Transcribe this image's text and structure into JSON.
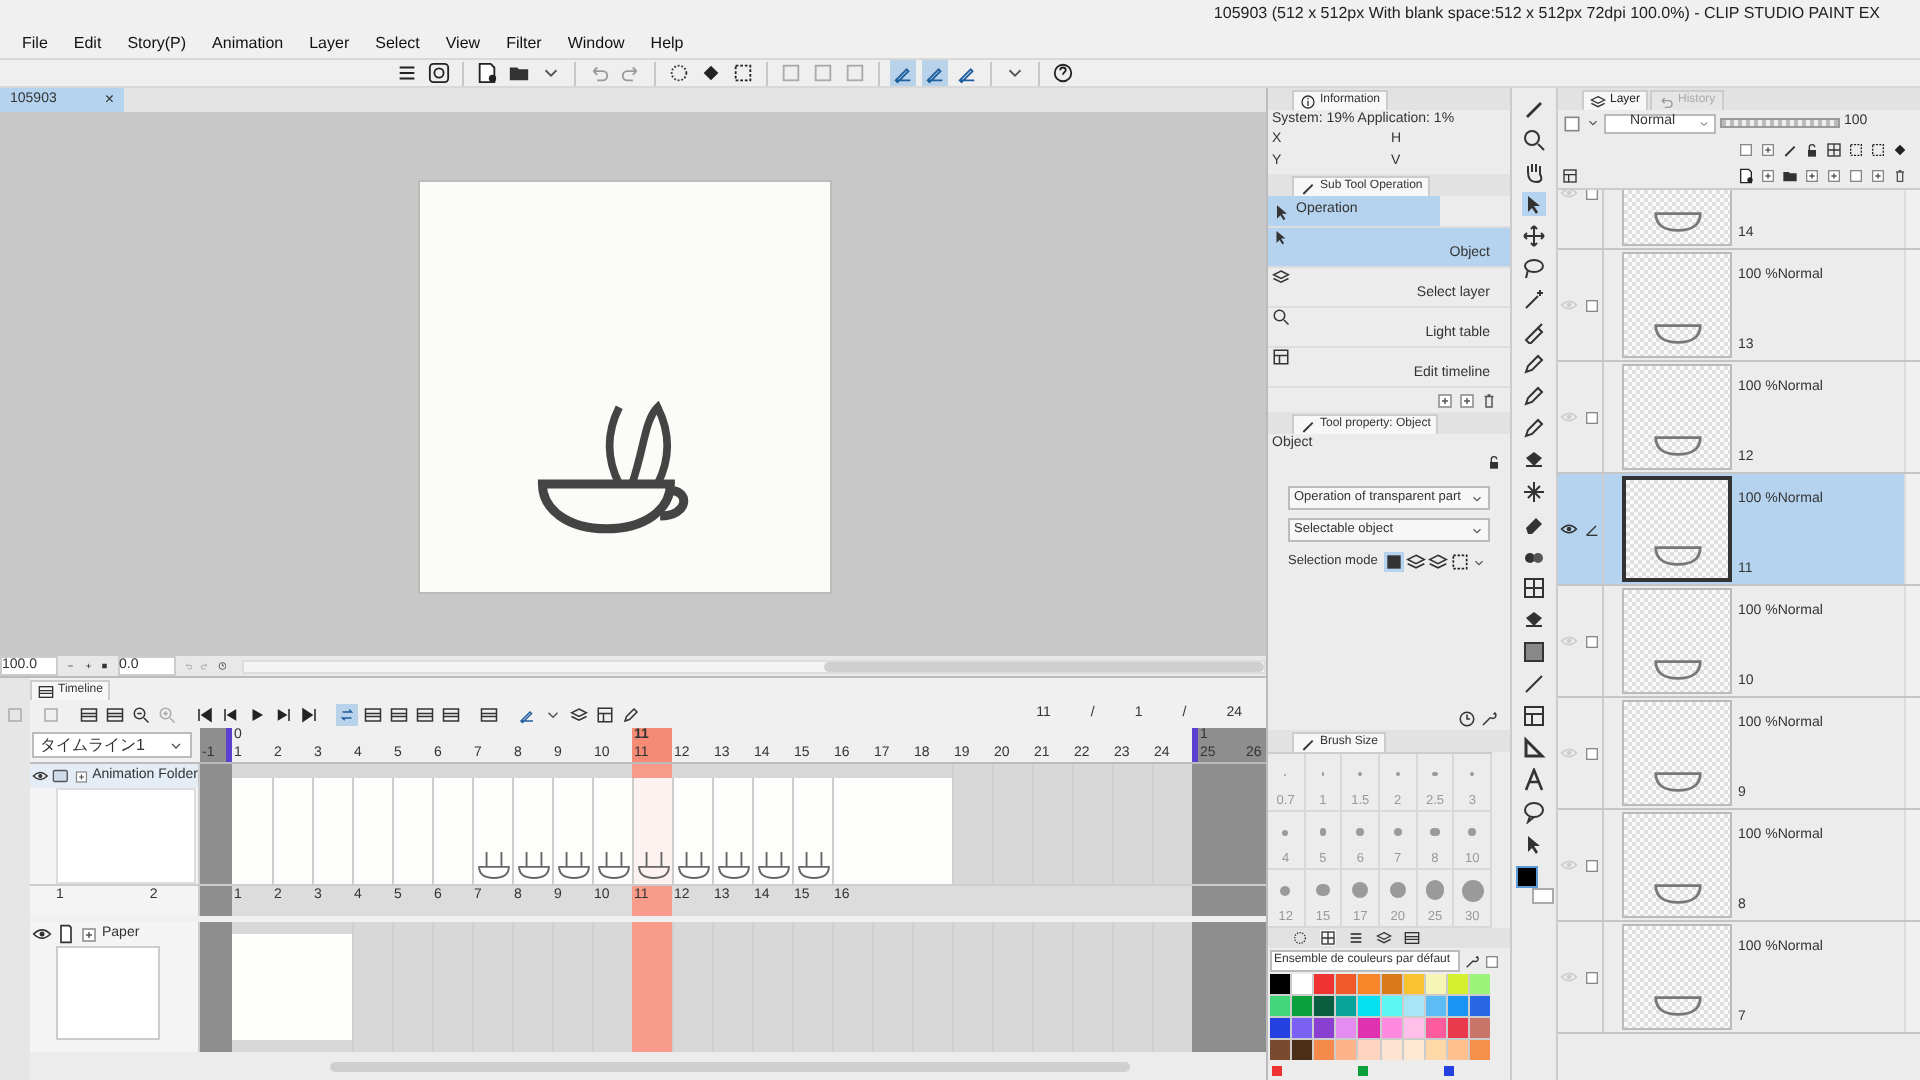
{
  "window": {
    "title": "105903 (512 x 512px With blank space:512 x 512px 72dpi 100.0%)  - CLIP STUDIO PAINT EX"
  },
  "menu": [
    "File",
    "Edit",
    "Story(P)",
    "Animation",
    "Layer",
    "Select",
    "View",
    "Filter",
    "Window",
    "Help"
  ],
  "document_tab": {
    "label": "105903",
    "close": "×",
    "selected": true
  },
  "canvas_status": {
    "zoom": "100.0",
    "angle": "0.0"
  },
  "information": {
    "title": "Information",
    "usage": "System: 19% Application:  1%",
    "labels": [
      "X",
      "Y",
      "H",
      "V"
    ]
  },
  "sub_tool": {
    "title": "Sub Tool Operation",
    "group": "Operation",
    "items": [
      {
        "label": "Object",
        "selected": true
      },
      {
        "label": "Select layer",
        "selected": false
      },
      {
        "label": "Light table",
        "selected": false
      },
      {
        "label": "Edit timeline",
        "selected": false
      }
    ]
  },
  "tool_property": {
    "title": "Tool property: Object",
    "name": "Object",
    "dropdowns": [
      "Operation of transparent part",
      "Selectable object"
    ],
    "selection_mode": "Selection mode"
  },
  "brush_size": {
    "title": "Brush Size",
    "sizes": [
      "0.7",
      "1",
      "1.5",
      "2",
      "2.5",
      "3",
      "4",
      "5",
      "6",
      "7",
      "8",
      "10",
      "12",
      "15",
      "17",
      "20",
      "25",
      "30"
    ]
  },
  "color_set": {
    "name": "Ensemble de couleurs par défaut",
    "colors": [
      {
        "color": "#000000"
      },
      {
        "color": "#ffffff"
      },
      {
        "color": "#ef3333"
      },
      {
        "color": "#f0592a"
      },
      {
        "color": "#f7862b"
      },
      {
        "color": "#d9791a"
      },
      {
        "color": "#f9c22e"
      },
      {
        "color": "#f7f5b5"
      },
      {
        "color": "#d4f02e"
      },
      {
        "color": "#9cf57a"
      },
      {
        "color": "#44d67a"
      },
      {
        "color": "#08a03a"
      },
      {
        "color": "#095e3f"
      },
      {
        "color": "#0aa39a"
      },
      {
        "color": "#06e0f0"
      },
      {
        "color": "#5ef5f5"
      },
      {
        "color": "#a8e5f7"
      },
      {
        "color": "#5cbcf5"
      },
      {
        "color": "#1994f5"
      },
      {
        "color": "#2867e6"
      },
      {
        "color": "#2340e0"
      },
      {
        "color": "#7a60f5"
      },
      {
        "color": "#8a3fd1"
      },
      {
        "color": "#e58cf0"
      },
      {
        "color": "#e031b0"
      },
      {
        "color": "#ff8ae0"
      },
      {
        "color": "#ffbfe8"
      },
      {
        "color": "#ff5c9e"
      },
      {
        "color": "#e83a4a"
      },
      {
        "color": "#c9756a"
      },
      {
        "color": "#7a4a30"
      },
      {
        "color": "#4a2e18"
      },
      {
        "color": "#f58a4a"
      },
      {
        "color": "#ffb38a"
      },
      {
        "color": "#ffd3bf"
      },
      {
        "color": "#ffe3d1"
      },
      {
        "color": "#ffe8d1"
      },
      {
        "color": "#ffd8a8"
      },
      {
        "color": "#ffc090"
      },
      {
        "color": "#f58f4a"
      }
    ],
    "recent": [
      {
        "color": "#ef3333"
      },
      {
        "color": "#08a03a"
      },
      {
        "color": "#2340e0"
      }
    ]
  },
  "layer_panel": {
    "tabs": [
      {
        "label": "Layer",
        "selected": true
      },
      {
        "label": "History",
        "selected": false
      }
    ],
    "blend": "Normal",
    "opacity_slider": {
      "level": 1
    },
    "opacity": "100",
    "layers": [
      {
        "number": "14",
        "selected": false
      },
      {
        "number": "13",
        "info": "100 %Normal",
        "selected": false
      },
      {
        "number": "12",
        "info": "100 %Normal",
        "selected": false
      },
      {
        "number": "11",
        "info": "100 %Normal",
        "selected": true
      },
      {
        "number": "10",
        "info": "100 %Normal",
        "selected": false
      },
      {
        "number": "9",
        "info": "100 %Normal",
        "selected": false
      },
      {
        "number": "8",
        "info": "100 %Normal",
        "selected": false
      },
      {
        "number": "7",
        "info": "100 %Normal",
        "selected": false
      }
    ]
  },
  "timeline": {
    "title": "Timeline",
    "counter": [
      "11",
      "/",
      "1",
      "/",
      "24"
    ],
    "name": "タイムライン1",
    "ruler": [
      {
        "label": "-1",
        "kind": "out",
        "selected": false
      },
      {
        "label": "1",
        "mark": "0",
        "kind": "frame",
        "selected": false
      },
      {
        "label": "2",
        "kind": "frame",
        "selected": false
      },
      {
        "label": "3",
        "kind": "frame",
        "selected": false
      },
      {
        "label": "4",
        "kind": "frame",
        "selected": false
      },
      {
        "label": "5",
        "kind": "frame",
        "selected": false
      },
      {
        "label": "6",
        "kind": "frame",
        "selected": false
      },
      {
        "label": "7",
        "kind": "frame",
        "selected": false
      },
      {
        "label": "8",
        "kind": "frame",
        "selected": false
      },
      {
        "label": "9",
        "kind": "frame",
        "selected": false
      },
      {
        "label": "10",
        "kind": "frame",
        "selected": false
      },
      {
        "label": "11",
        "mark": "11",
        "kind": "frame",
        "selected": true
      },
      {
        "label": "12",
        "kind": "frame",
        "selected": false
      },
      {
        "label": "13",
        "kind": "frame",
        "selected": false
      },
      {
        "label": "14",
        "kind": "frame",
        "selected": false
      },
      {
        "label": "15",
        "kind": "frame",
        "selected": false
      },
      {
        "label": "16",
        "kind": "frame",
        "selected": false
      },
      {
        "label": "17",
        "kind": "frame",
        "selected": false
      },
      {
        "label": "18",
        "kind": "frame",
        "selected": false
      },
      {
        "label": "19",
        "kind": "frame",
        "selected": false
      },
      {
        "label": "20",
        "kind": "frame",
        "selected": false
      },
      {
        "label": "21",
        "kind": "frame",
        "selected": false
      },
      {
        "label": "22",
        "kind": "frame",
        "selected": false
      },
      {
        "label": "23",
        "kind": "frame",
        "selected": false
      },
      {
        "label": "24",
        "kind": "frame",
        "selected": false
      },
      {
        "label": "25",
        "mark": "1",
        "kind": "out",
        "selected": false
      },
      {
        "label": "26",
        "kind": "out",
        "selected": false
      }
    ],
    "tracks": [
      {
        "label": "Animation Folder",
        "kind": "folder",
        "header_ruler": [
          "1",
          "2"
        ],
        "cels": [
          {
            "label": "1",
            "drawn": false
          },
          {
            "label": "2",
            "drawn": false
          },
          {
            "label": "3",
            "drawn": false
          },
          {
            "label": "4",
            "drawn": false
          },
          {
            "label": "5",
            "drawn": false
          },
          {
            "label": "6",
            "drawn": false
          },
          {
            "label": "7",
            "drawn": true
          },
          {
            "label": "8",
            "drawn": true
          },
          {
            "label": "9",
            "drawn": true
          },
          {
            "label": "10",
            "drawn": true
          },
          {
            "label": "11",
            "drawn": true
          },
          {
            "label": "12",
            "drawn": true
          },
          {
            "label": "13",
            "drawn": true
          },
          {
            "label": "14",
            "drawn": true
          },
          {
            "label": "15",
            "drawn": true
          },
          {
            "label": "16",
            "drawn": false,
            "kind": "held"
          }
        ]
      },
      {
        "label": "Paper",
        "kind": "paper",
        "cels": [
          {
            "kind": "held"
          }
        ]
      }
    ]
  }
}
